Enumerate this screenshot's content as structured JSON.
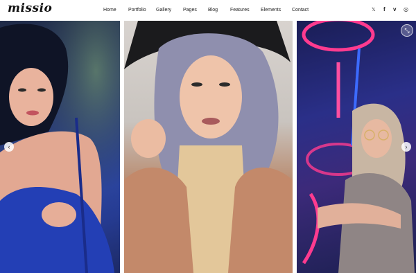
{
  "site": {
    "logo": "missio"
  },
  "nav": {
    "items": [
      {
        "label": "Home"
      },
      {
        "label": "Portfolio"
      },
      {
        "label": "Gallery"
      },
      {
        "label": "Pages"
      },
      {
        "label": "Blog"
      },
      {
        "label": "Features"
      },
      {
        "label": "Elements"
      },
      {
        "label": "Contact"
      }
    ]
  },
  "social": {
    "twitter": "𝕏",
    "facebook": "f",
    "vimeo": "v",
    "instagram": "◎"
  },
  "slider": {
    "prev_label": "‹",
    "next_label": "›",
    "expand_label": "⤡"
  },
  "colors": {
    "accent": "#2a44a8",
    "neon_pink": "#ff2f8a",
    "neon_blue": "#2c6bff"
  }
}
